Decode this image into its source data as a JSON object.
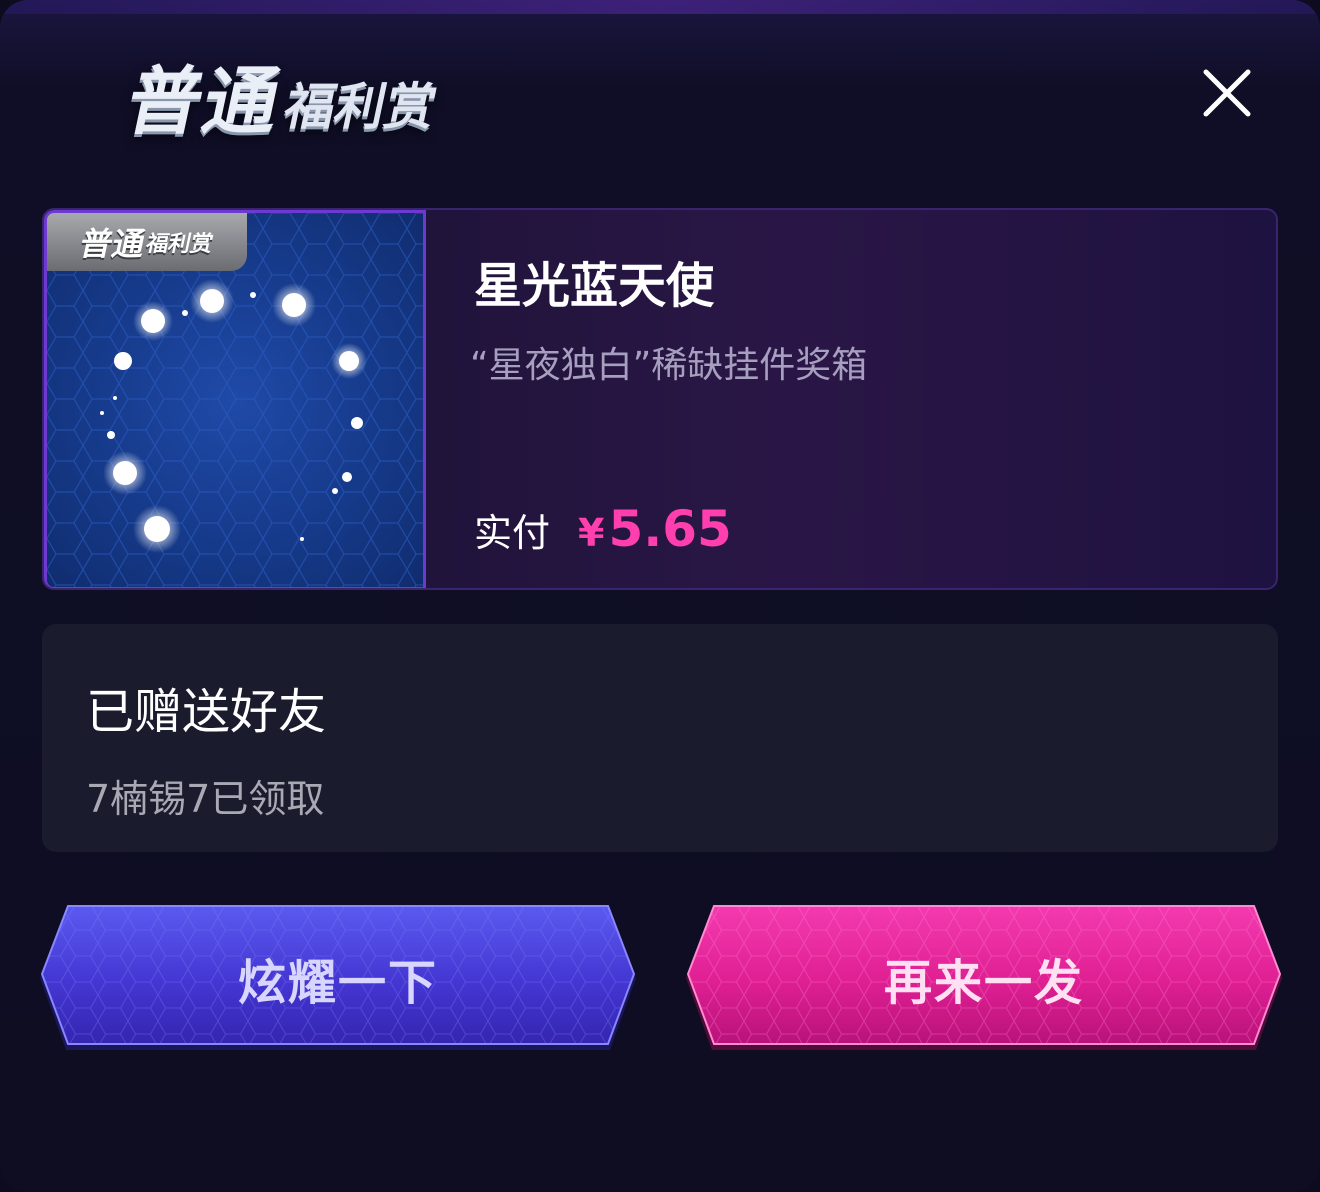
{
  "header": {
    "logo_big": "普通",
    "logo_small": "福利赏"
  },
  "prize": {
    "tag_big": "普通",
    "tag_small": "福利赏",
    "name": "星光蓝天使",
    "description": "“星夜独白”稀缺挂件奖箱",
    "price_label": "实付",
    "currency": "¥",
    "price": "5.65"
  },
  "gift": {
    "title": "已赠送好友",
    "status": "7楠锡7已领取"
  },
  "buttons": {
    "show_off": "炫耀一下",
    "again": "再来一发"
  },
  "colors": {
    "accent_pink": "#ff3fae",
    "button_blue": "#4a3ad8",
    "button_pink": "#e0228f"
  }
}
